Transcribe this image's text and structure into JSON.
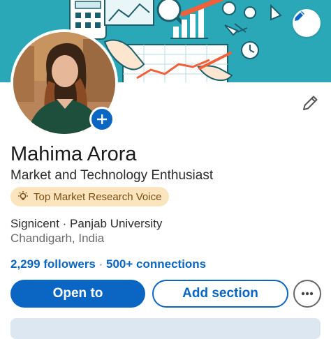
{
  "profile": {
    "name": "Mahima Arora",
    "headline": "Market and Technology Enthusiast",
    "badge": "Top Market Research Voice",
    "organization": "Signicent · Panjab University",
    "location": "Chandigarh, India",
    "followers": "2,299 followers",
    "separator": " · ",
    "connections": "500+ connections"
  },
  "actions": {
    "open_to": "Open to",
    "add_section": "Add section"
  },
  "icons": {
    "banner_edit": "pencil-icon",
    "profile_edit": "pencil-icon",
    "add_photo": "plus-icon",
    "badge": "lightbulb-icon",
    "more": "ellipsis-icon"
  },
  "colors": {
    "brand_blue": "#0a66c2",
    "banner_teal": "#2aa8b8",
    "badge_bg": "#fbe5bf"
  }
}
